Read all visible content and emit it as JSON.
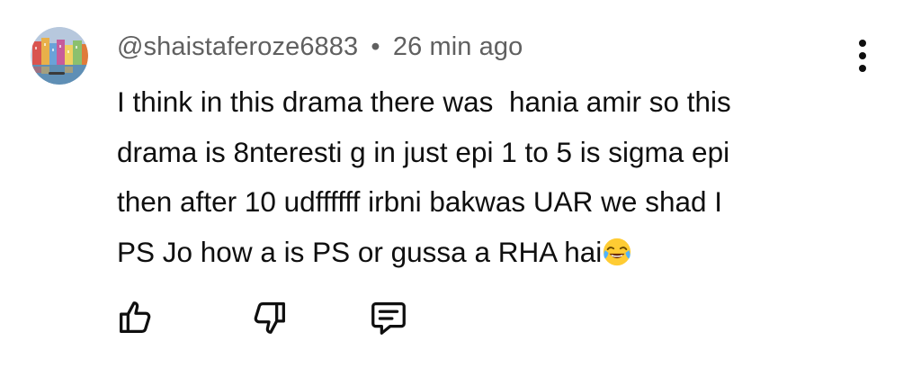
{
  "comment": {
    "author": "@shaistaferoze6883",
    "separator": "•",
    "time_ago": "26 min ago",
    "lines": [
      "I think in this drama there was  hania amir so this",
      "drama is 8nteresti g in just epi 1 to 5 is sigma epi",
      "then after 10 udffffff irbni bakwas UAR we shad I",
      "PS Jo how a is PS or gussa a RHA hai"
    ],
    "trailing_emoji": "face-with-tears-of-joy-emoji"
  },
  "actions": {
    "like_icon": "thumbs-up-icon",
    "dislike_icon": "thumbs-down-icon",
    "reply_icon": "reply-comment-icon",
    "menu_icon": "more-vertical-icon"
  },
  "colors": {
    "text": "#0f0f0f",
    "meta": "#606060",
    "background": "#ffffff"
  }
}
